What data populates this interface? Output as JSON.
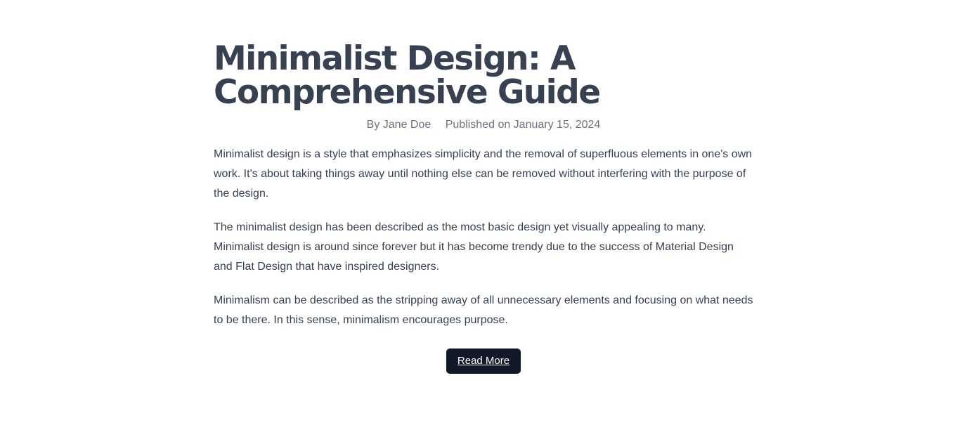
{
  "article": {
    "title": "Minimalist Design: A Comprehensive Guide",
    "author": "By Jane Doe",
    "published": "Published on January 15, 2024",
    "paragraphs": [
      "Minimalist design is a style that emphasizes simplicity and the removal of superfluous elements in one's own work. It's about taking things away until nothing else can be removed without interfering with the purpose of the design.",
      "The minimalist design has been described as the most basic design yet visually appealing to many. Minimalist design is around since forever but it has become trendy due to the success of Material Design and Flat Design that have inspired designers.",
      "Minimalism can be described as the stripping away of all unnecessary elements and focusing on what needs to be there. In this sense, minimalism encourages purpose."
    ],
    "read_more_label": "Read More"
  },
  "colors": {
    "title": "#374151",
    "meta": "#6b7280",
    "body": "#374151",
    "button_bg": "#111827",
    "button_text": "#ffffff"
  }
}
